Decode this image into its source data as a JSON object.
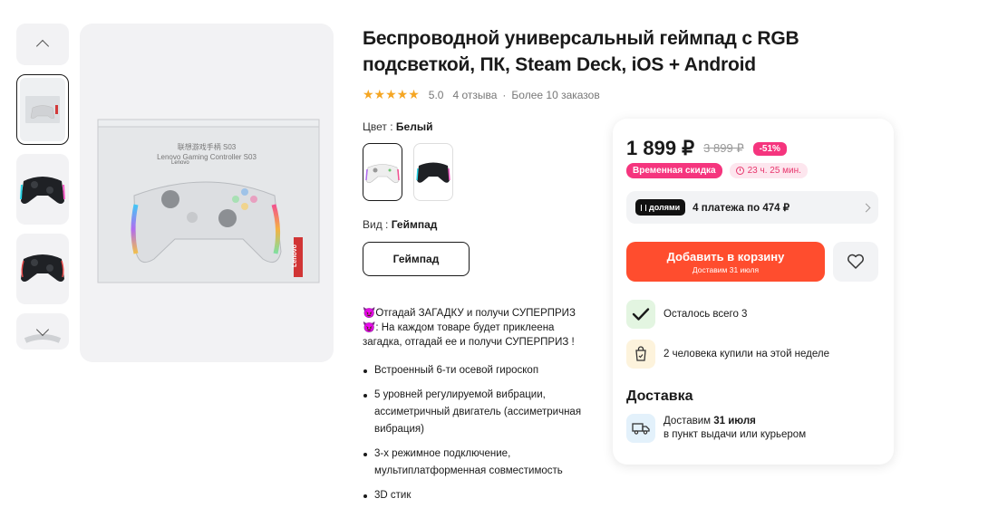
{
  "product": {
    "title": "Беспроводной универсальный геймпад с RGB подсветкой, ПК, Steam Deck, iOS + Android",
    "rating": {
      "stars": "★★★★★",
      "value": "5.0",
      "reviews": "4 отзыва",
      "separator": "·",
      "orders": "Более 10 заказов"
    },
    "color": {
      "label": "Цвет :",
      "selected": "Белый",
      "options": [
        "white-gamepad-swatch",
        "black-gamepad-swatch"
      ]
    },
    "variant": {
      "label": "Вид :",
      "selected": "Геймпад",
      "button_label": "Геймпад"
    },
    "description": {
      "line1": "Отгадай ЗАГАДКУ и получи СУПЕРПРИЗ",
      "line2": ": На каждом товаре будет приклеена загадка, отгадай ее и получи СУПЕРПРИЗ !",
      "bullets": [
        "Встроенный 6-ти осевой гироскоп",
        "5 уровней регулируемой вибрации, ассиметричный двигатель (ассиметричная вибрация)",
        "3-х режимное подключение, мультиплатформенная совместимость",
        "3D стик"
      ]
    },
    "box_text": {
      "line1": "联想游戏手柄 S03",
      "line2": "Lenovo Gaming Controller S03",
      "brand": "Lenovo"
    }
  },
  "buy_card": {
    "price": "1 899 ₽",
    "old_price": "3 899 ₽",
    "discount": "-51%",
    "sale_badge": "Временная скидка",
    "timer": "23 ч. 25 мин.",
    "installments": {
      "brand": "долями",
      "text": "4 платежа по 474 ₽"
    },
    "cart_button": {
      "label": "Добавить в корзину",
      "sublabel": "Доставим 31 июля"
    },
    "stock": "Осталось всего 3",
    "buyers": "2 человека купили на этой неделе",
    "delivery": {
      "heading": "Доставка",
      "prefix": "Доставим ",
      "date": "31 июля",
      "line2": "в пункт выдачи или курьером"
    }
  },
  "colors": {
    "accent": "#ff4d2e",
    "pink": "#f5357e",
    "star": "#f5a623",
    "green_bg": "#e3f5e1",
    "yellow_bg": "#fdf3dc",
    "blue_bg": "#e3f1fb"
  }
}
